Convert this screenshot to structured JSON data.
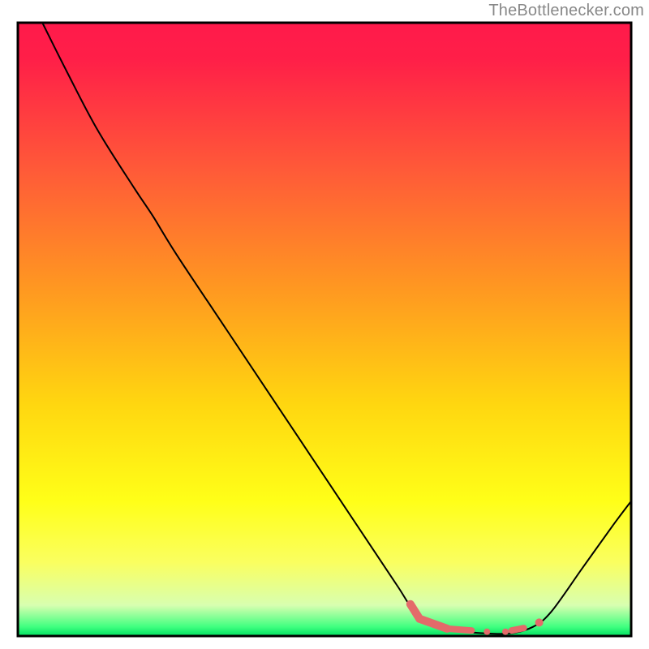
{
  "watermark": {
    "text": "TheBottlenecker.com"
  },
  "chart_data": {
    "type": "line",
    "title": "",
    "xlabel": "",
    "ylabel": "",
    "xlim": [
      0,
      100
    ],
    "ylim": [
      0,
      100
    ],
    "grid": false,
    "legend": false,
    "gradient_stops": [
      {
        "offset": 0.0,
        "color": "#ff1a4b"
      },
      {
        "offset": 0.06,
        "color": "#ff1f48"
      },
      {
        "offset": 0.24,
        "color": "#ff5a38"
      },
      {
        "offset": 0.44,
        "color": "#ff9a20"
      },
      {
        "offset": 0.62,
        "color": "#ffd610"
      },
      {
        "offset": 0.78,
        "color": "#ffff18"
      },
      {
        "offset": 0.88,
        "color": "#faff60"
      },
      {
        "offset": 0.95,
        "color": "#d8ffb0"
      },
      {
        "offset": 0.985,
        "color": "#40ff80"
      },
      {
        "offset": 1.0,
        "color": "#00e060"
      }
    ],
    "series": [
      {
        "name": "bottleneck-curve",
        "stroke": "#000000",
        "stroke_width": 2,
        "points": [
          {
            "x": 4.0,
            "y": 100.0
          },
          {
            "x": 8.0,
            "y": 92.0
          },
          {
            "x": 13.0,
            "y": 82.5
          },
          {
            "x": 19.0,
            "y": 73.0
          },
          {
            "x": 22.0,
            "y": 68.5
          },
          {
            "x": 26.0,
            "y": 62.0
          },
          {
            "x": 34.0,
            "y": 50.0
          },
          {
            "x": 46.0,
            "y": 32.0
          },
          {
            "x": 58.0,
            "y": 14.0
          },
          {
            "x": 62.0,
            "y": 8.0
          },
          {
            "x": 65.0,
            "y": 3.5
          },
          {
            "x": 68.0,
            "y": 1.5
          },
          {
            "x": 74.0,
            "y": 0.6
          },
          {
            "x": 80.0,
            "y": 0.4
          },
          {
            "x": 84.0,
            "y": 1.5
          },
          {
            "x": 87.0,
            "y": 4.0
          },
          {
            "x": 92.0,
            "y": 11.0
          },
          {
            "x": 97.0,
            "y": 18.0
          },
          {
            "x": 100.0,
            "y": 22.0
          }
        ]
      }
    ],
    "markers": {
      "color": "#e46a6a",
      "stroke": "#e46a6a",
      "items": [
        {
          "type": "segment",
          "x1": 64.0,
          "y1": 5.2,
          "x2": 65.5,
          "y2": 2.8,
          "w": 10
        },
        {
          "type": "segment",
          "x1": 65.5,
          "y1": 2.8,
          "x2": 70.0,
          "y2": 1.2,
          "w": 10
        },
        {
          "type": "segment",
          "x1": 70.0,
          "y1": 1.2,
          "x2": 74.0,
          "y2": 0.9,
          "w": 8
        },
        {
          "type": "dot",
          "x": 76.5,
          "y": 0.7,
          "r": 4
        },
        {
          "type": "dot",
          "x": 79.5,
          "y": 0.7,
          "r": 4
        },
        {
          "type": "segment",
          "x1": 80.5,
          "y1": 0.9,
          "x2": 82.5,
          "y2": 1.3,
          "w": 8
        },
        {
          "type": "dot",
          "x": 85.0,
          "y": 2.2,
          "r": 5
        }
      ]
    }
  }
}
